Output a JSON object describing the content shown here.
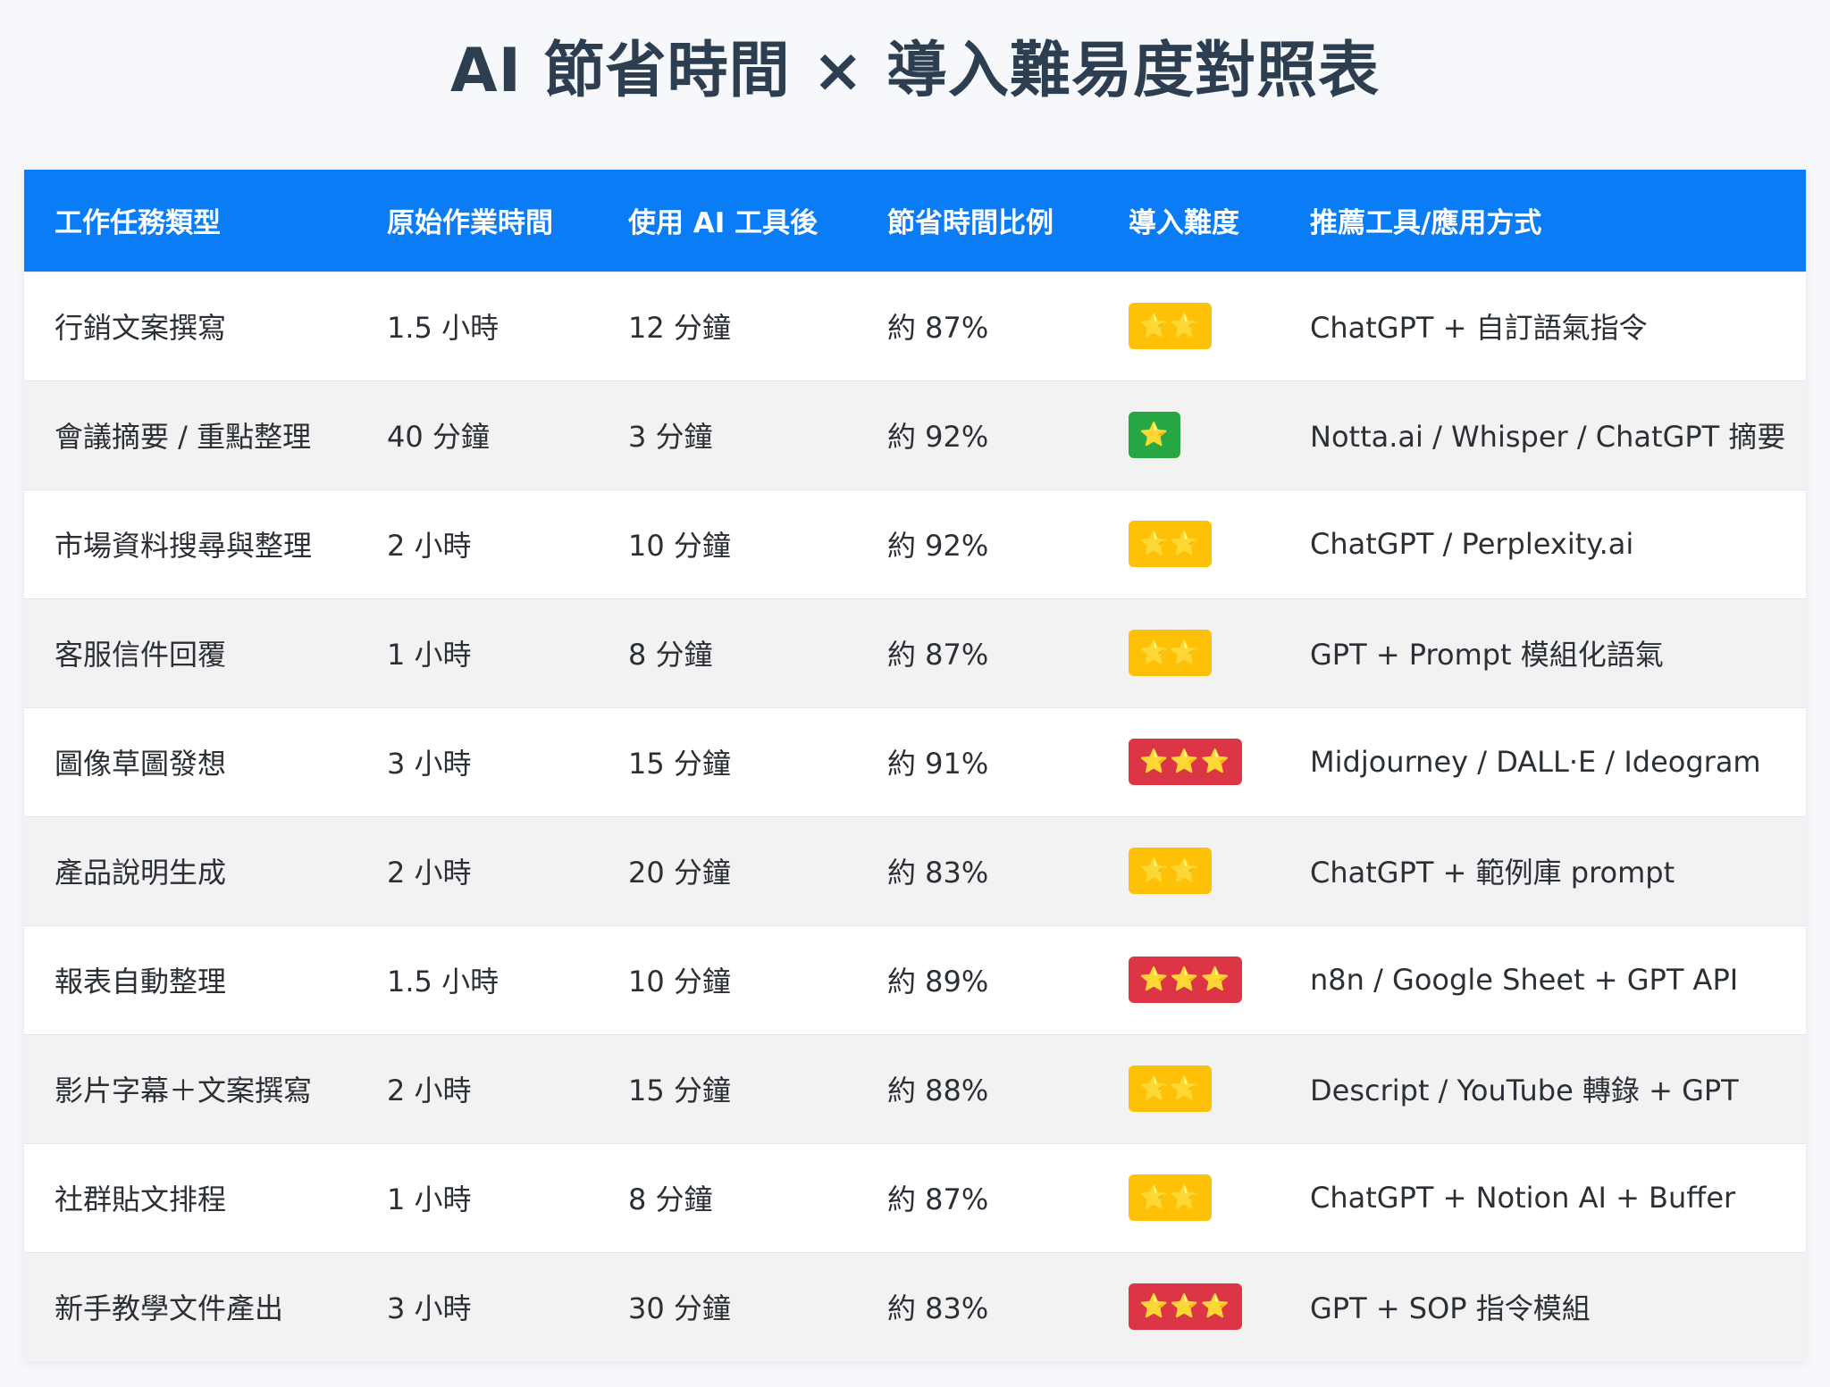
{
  "title": "AI 節省時間 × 導入難易度對照表",
  "headers": [
    "工作任務類型",
    "原始作業時間",
    "使用 AI 工具後",
    "節省時間比例",
    "導入難度",
    "推薦工具/應用方式"
  ],
  "difficulty_colors": {
    "1": "#28a745",
    "2": "#ffc107",
    "3": "#dc3545"
  },
  "rows": [
    {
      "task": "行銷文案撰寫",
      "original": "1.5 小時",
      "after": "12 分鐘",
      "saving": "約 87%",
      "difficulty": 2,
      "stars": "⭐⭐",
      "tools": "ChatGPT + 自訂語氣指令"
    },
    {
      "task": "會議摘要 / 重點整理",
      "original": "40 分鐘",
      "after": "3 分鐘",
      "saving": "約 92%",
      "difficulty": 1,
      "stars": "⭐",
      "tools": "Notta.ai / Whisper / ChatGPT 摘要"
    },
    {
      "task": "市場資料搜尋與整理",
      "original": "2 小時",
      "after": "10 分鐘",
      "saving": "約 92%",
      "difficulty": 2,
      "stars": "⭐⭐",
      "tools": "ChatGPT / Perplexity.ai"
    },
    {
      "task": "客服信件回覆",
      "original": "1 小時",
      "after": "8 分鐘",
      "saving": "約 87%",
      "difficulty": 2,
      "stars": "⭐⭐",
      "tools": "GPT + Prompt 模組化語氣"
    },
    {
      "task": "圖像草圖發想",
      "original": "3 小時",
      "after": "15 分鐘",
      "saving": "約 91%",
      "difficulty": 3,
      "stars": "⭐⭐⭐",
      "tools": "Midjourney / DALL·E / Ideogram"
    },
    {
      "task": "產品說明生成",
      "original": "2 小時",
      "after": "20 分鐘",
      "saving": "約 83%",
      "difficulty": 2,
      "stars": "⭐⭐",
      "tools": "ChatGPT + 範例庫 prompt"
    },
    {
      "task": "報表自動整理",
      "original": "1.5 小時",
      "after": "10 分鐘",
      "saving": "約 89%",
      "difficulty": 3,
      "stars": "⭐⭐⭐",
      "tools": "n8n / Google Sheet + GPT API"
    },
    {
      "task": "影片字幕＋文案撰寫",
      "original": "2 小時",
      "after": "15 分鐘",
      "saving": "約 88%",
      "difficulty": 2,
      "stars": "⭐⭐",
      "tools": "Descript / YouTube 轉錄 + GPT"
    },
    {
      "task": "社群貼文排程",
      "original": "1 小時",
      "after": "8 分鐘",
      "saving": "約 87%",
      "difficulty": 2,
      "stars": "⭐⭐",
      "tools": "ChatGPT + Notion AI + Buffer"
    },
    {
      "task": "新手教學文件產出",
      "original": "3 小時",
      "after": "30 分鐘",
      "saving": "約 83%",
      "difficulty": 3,
      "stars": "⭐⭐⭐",
      "tools": "GPT + SOP 指令模組"
    }
  ]
}
